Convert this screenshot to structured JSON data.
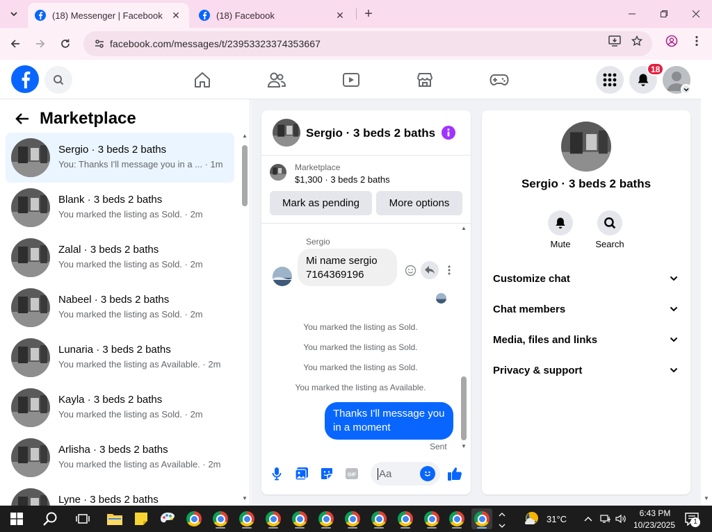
{
  "browser": {
    "tabs": [
      {
        "title": "(18) Messenger | Facebook",
        "active": true
      },
      {
        "title": "(18) Facebook",
        "active": false
      }
    ],
    "url": "facebook.com/messages/t/23953323374353667"
  },
  "fb_header": {
    "notification_count": "18",
    "nav_icons": [
      "home-icon",
      "friends-icon",
      "video-icon",
      "marketplace-icon",
      "gaming-icon"
    ]
  },
  "left_panel": {
    "title": "Marketplace",
    "conversations": [
      {
        "name": "Sergio · 3 beds 2 baths",
        "snippet": "You: Thanks I'll message you in a ... · 1m",
        "selected": true
      },
      {
        "name": "Blank · 3 beds 2 baths",
        "snippet": "You marked the listing as Sold. · 2m"
      },
      {
        "name": "Zalal · 3 beds 2 baths",
        "snippet": "You marked the listing as Sold. · 2m"
      },
      {
        "name": "Nabeel · 3 beds 2 baths",
        "snippet": "You marked the listing as Sold. · 2m"
      },
      {
        "name": "Lunaria · 3 beds 2 baths",
        "snippet": "You marked the listing as Available. · 2m"
      },
      {
        "name": "Kayla · 3 beds 2 baths",
        "snippet": "You marked the listing as Sold. · 2m"
      },
      {
        "name": "Arlisha · 3 beds 2 baths",
        "snippet": "You marked the listing as Available. · 2m"
      },
      {
        "name": "Lyne · 3 beds 2 baths",
        "snippet": ""
      }
    ]
  },
  "chat": {
    "title": "Sergio · 3 beds 2 baths",
    "listing": {
      "label": "Marketplace",
      "price": "$1,300 · 3 beds 2 baths"
    },
    "buttons": {
      "pending": "Mark as pending",
      "more": "More options"
    },
    "sender": "Sergio",
    "incoming_message": [
      "Mi name sergio",
      "7164369196"
    ],
    "system_messages": [
      "You marked the listing as Sold.",
      "You marked the listing as Sold.",
      "You marked the listing as Sold.",
      "You marked the listing as Available."
    ],
    "outgoing_message": [
      "Thanks I'll message you",
      "in a moment"
    ],
    "status": "Sent",
    "composer_placeholder": "Aa"
  },
  "info_panel": {
    "name": "Sergio · 3 beds 2 baths",
    "actions": [
      {
        "label": "Mute",
        "icon": "bell-icon"
      },
      {
        "label": "Search",
        "icon": "search-icon"
      }
    ],
    "sections": [
      "Customize chat",
      "Chat members",
      "Media, files and links",
      "Privacy & support"
    ]
  },
  "taskbar": {
    "weather": "31°C",
    "time": "6:43 PM",
    "date": "10/23/2025",
    "notification_count": "1"
  },
  "colors": {
    "fb_blue": "#0866ff",
    "selected_bg": "#ebf5ff",
    "tab_strip": "#f9dced",
    "info_purple": "#a033ff",
    "badge_red": "#e41e3f"
  }
}
